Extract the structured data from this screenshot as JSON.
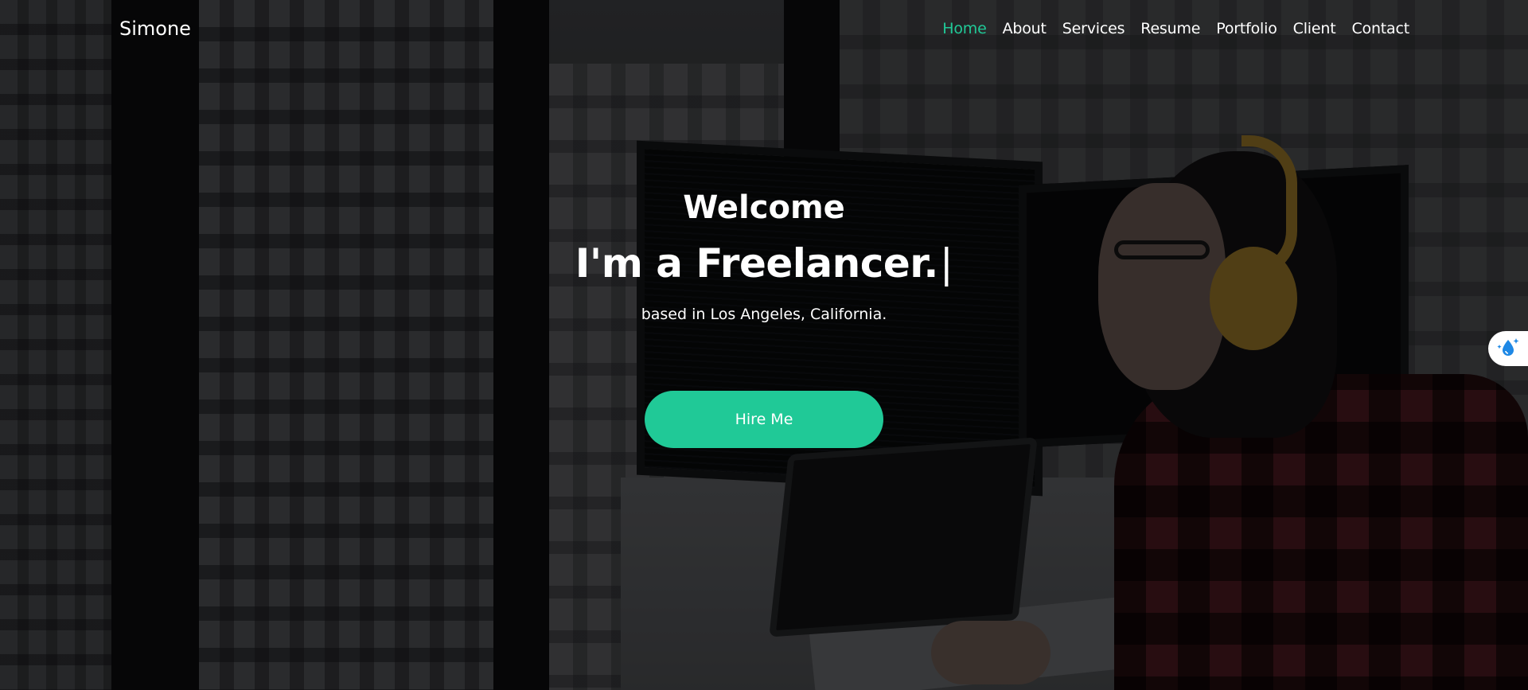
{
  "brand": {
    "name": "Simone"
  },
  "nav": {
    "items": [
      {
        "label": "Home",
        "active": true
      },
      {
        "label": "About",
        "active": false
      },
      {
        "label": "Services",
        "active": false
      },
      {
        "label": "Resume",
        "active": false
      },
      {
        "label": "Portfolio",
        "active": false
      },
      {
        "label": "Client",
        "active": false
      },
      {
        "label": "Contact",
        "active": false
      }
    ]
  },
  "hero": {
    "welcome": "Welcome",
    "headline": "I'm a Freelancer.",
    "cursor": "|",
    "subtitle": "based in Los Angeles, California.",
    "cta_label": "Hire Me"
  },
  "side_widget": {
    "icon": "water-drop-sparkle-icon"
  },
  "colors": {
    "accent": "#20c997",
    "text": "#ffffff",
    "overlay": "rgba(0,0,0,0.55)"
  }
}
